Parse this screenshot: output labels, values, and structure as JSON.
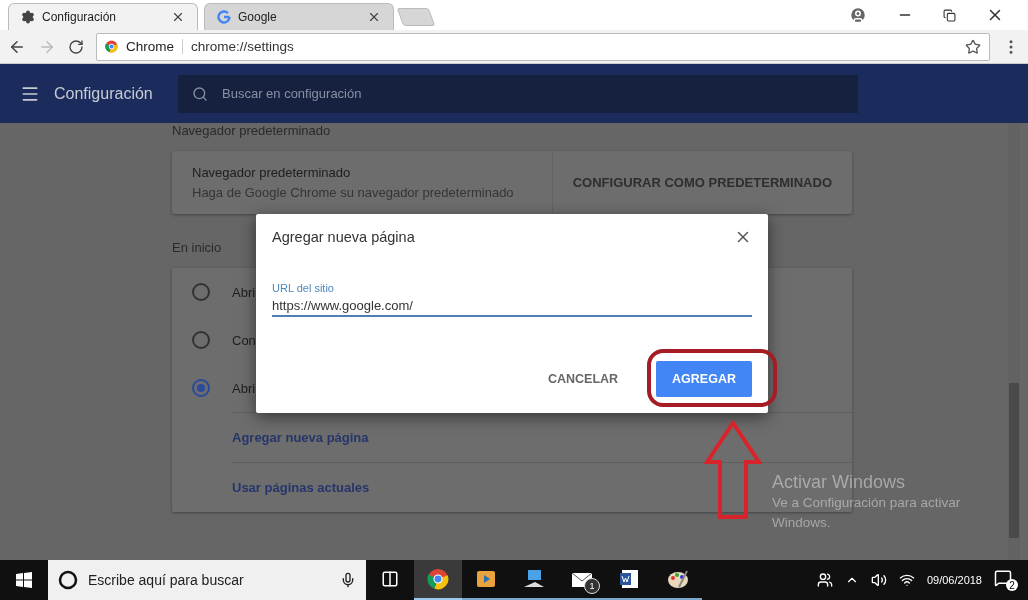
{
  "browser": {
    "tabs": [
      {
        "title": "Configuración",
        "selected": true,
        "kind": "settings"
      },
      {
        "title": "Google",
        "selected": false,
        "kind": "google"
      }
    ],
    "address_bar": {
      "site_label": "Chrome",
      "url": "chrome://settings"
    }
  },
  "header": {
    "title": "Configuración",
    "search": {
      "placeholder": "Buscar en configuración"
    }
  },
  "default_browser": {
    "heading": "Navegador predeterminado",
    "title": "Navegador predeterminado",
    "subtitle": "Haga de Google Chrome su navegador predeterminado",
    "action": "CONFIGURAR COMO PREDETERMINADO"
  },
  "startup": {
    "heading": "En inicio",
    "options": [
      {
        "label": "Abri",
        "selected": false
      },
      {
        "label": "Con",
        "selected": false
      },
      {
        "label": "Abri",
        "selected": true
      }
    ],
    "links": [
      "Agregar nueva página",
      "Usar páginas actuales"
    ]
  },
  "dialog": {
    "title": "Agregar nueva página",
    "field": {
      "label": "URL del sitio",
      "value": "https://www.google.com/"
    },
    "buttons": [
      {
        "label": "CANCELAR",
        "kind": "text"
      },
      {
        "label": "AGREGAR",
        "kind": "primary"
      }
    ]
  },
  "activation_notice": {
    "title": "Activar Windows",
    "text": "Ve a Configuración para activar Windows."
  },
  "taskbar": {
    "search": {
      "placeholder": "Escribe aquí para buscar"
    },
    "apps": [
      {
        "kind": "chrome",
        "selected": true
      },
      {
        "kind": "media",
        "selected": false
      },
      {
        "kind": "desktop",
        "selected": false
      },
      {
        "kind": "mail",
        "selected": false,
        "badge": "1"
      },
      {
        "kind": "word",
        "selected": false
      },
      {
        "kind": "paint",
        "selected": false
      }
    ],
    "date": "09/06/2018",
    "notifications": "2"
  }
}
